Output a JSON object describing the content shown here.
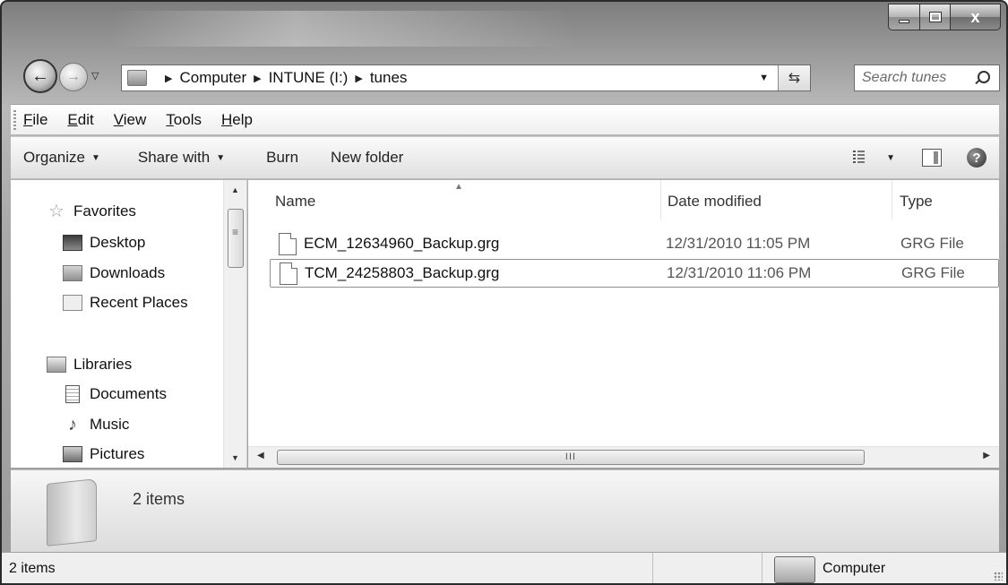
{
  "window": {
    "caption": {
      "minimize": "",
      "maximize": "",
      "close": "x"
    }
  },
  "navigation": {
    "breadcrumbs": [
      "Computer",
      "INTUNE (I:)",
      "tunes"
    ],
    "search_placeholder": "Search tunes"
  },
  "menubar": {
    "items": [
      {
        "key": "F",
        "rest": "ile"
      },
      {
        "key": "E",
        "rest": "dit"
      },
      {
        "key": "V",
        "rest": "iew"
      },
      {
        "key": "T",
        "rest": "ools"
      },
      {
        "key": "H",
        "rest": "elp"
      }
    ]
  },
  "toolbar": {
    "organize": "Organize",
    "share_with": "Share with",
    "burn": "Burn",
    "new_folder": "New folder",
    "help": "?"
  },
  "sidebar": {
    "favorites": "Favorites",
    "items": [
      {
        "label": "Desktop",
        "icon": "desktop-icon"
      },
      {
        "label": "Downloads",
        "icon": "downloads-icon"
      },
      {
        "label": "Recent Places",
        "icon": "recent-places-icon"
      }
    ],
    "libraries": "Libraries",
    "library_items": [
      {
        "label": "Documents",
        "icon": "documents-icon"
      },
      {
        "label": "Music",
        "icon": "music-icon"
      },
      {
        "label": "Pictures",
        "icon": "pictures-icon"
      }
    ]
  },
  "filelist": {
    "columns": {
      "name": "Name",
      "date": "Date modified",
      "type": "Type"
    },
    "rows": [
      {
        "name": "ECM_12634960_Backup.grg",
        "date": "12/31/2010 11:05 PM",
        "type": "GRG File"
      },
      {
        "name": "TCM_24258803_Backup.grg",
        "date": "12/31/2010 11:06 PM",
        "type": "GRG File"
      }
    ],
    "scroll_thumb_grip": "III"
  },
  "details": {
    "count": "2 items"
  },
  "statusbar": {
    "items": "2 items",
    "zone": "Computer"
  }
}
